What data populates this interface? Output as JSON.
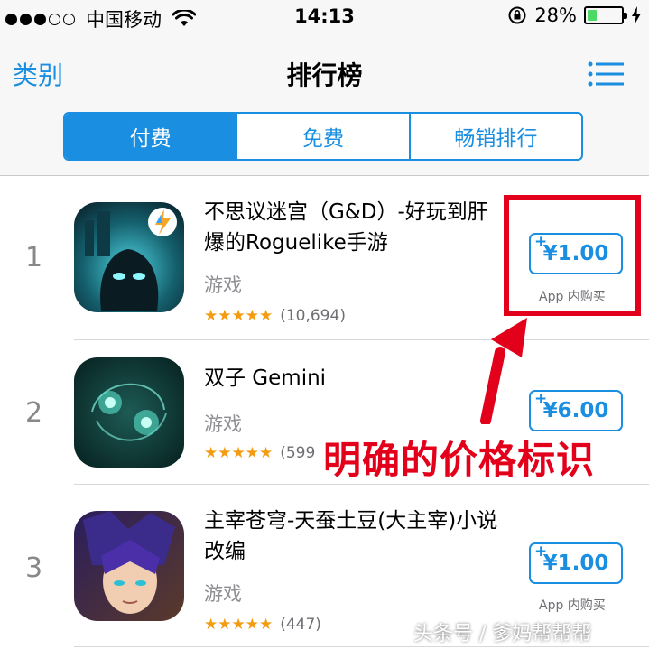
{
  "status_bar": {
    "carrier": "中国移动",
    "time": "14:13",
    "battery_percent": "28%",
    "battery_level": 0.28,
    "signal_bars_filled": 3,
    "signal_bars_total": 5
  },
  "nav": {
    "left_label": "类别",
    "title": "排行榜",
    "right_icon": "list-icon"
  },
  "segments": [
    {
      "label": "付费",
      "active": true
    },
    {
      "label": "免费",
      "active": false
    },
    {
      "label": "畅销排行",
      "active": false
    }
  ],
  "apps": [
    {
      "rank": "1",
      "title": "不思议迷宫（G&D）-好玩到肝爆的Roguelike手游",
      "category": "游戏",
      "stars": "★★★★★",
      "rating_count": "(10,694)",
      "price": "¥1.00",
      "iap": "App 内购买"
    },
    {
      "rank": "2",
      "title": "双子 Gemini",
      "category": "游戏",
      "stars": "★★★★★",
      "rating_count": "(599",
      "price": "¥6.00",
      "iap": ""
    },
    {
      "rank": "3",
      "title": "主宰苍穹-天蚕土豆(大主宰)小说改编",
      "category": "游戏",
      "stars": "★★★★★",
      "rating_count": "(447)",
      "price": "¥1.00",
      "iap": "App 内购买"
    }
  ],
  "annotation": {
    "text": "明确的价格标识",
    "color": "#e3001b"
  },
  "watermark": "头条号 / 爹妈帮帮帮",
  "colors": {
    "accent": "#1a8ee0",
    "star": "#f39c12",
    "battery": "#4cd964"
  }
}
